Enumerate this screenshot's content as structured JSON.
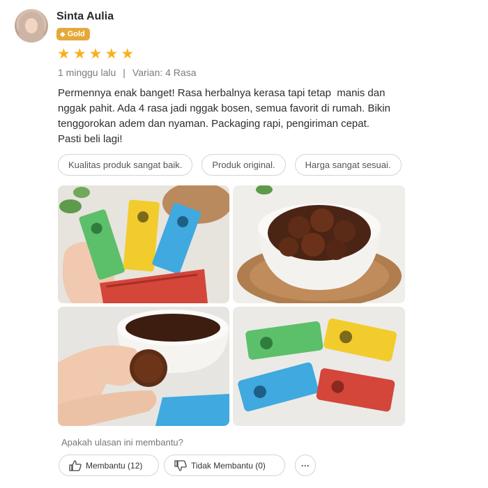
{
  "reviewer": {
    "name": "Sinta Aulia",
    "badge": "Gold",
    "badge_icon": "diamond-icon",
    "rating": 5
  },
  "meta": {
    "time": "1 minggu lalu",
    "separator": "|",
    "variant": "Varian: 4 Rasa"
  },
  "review": {
    "line1": "Permennya enak banget! Rasa herbalnya kerasa tapi tetap  manis dan",
    "line2": "nggak pahit. Ada 4 rasa jadi nggak bosen, semua favorit di rumah. Bikin",
    "line3": "tenggorokan adem dan nyaman. Packaging rapi, pengiriman cepat.",
    "line4": "Pasti beli lagi!"
  },
  "tags": [
    "Kualitas produk sangat baik.",
    "Produk original.",
    "Harga sangat sesuai."
  ],
  "helpful": {
    "question": "Apakah ulasan ini membantu?",
    "yes_label": "Membantu (12)",
    "no_label": "Tidak Membantu (0)",
    "more_label": "···"
  },
  "colors": {
    "star": "#f6b21b",
    "badge": "#e5a93a",
    "candy_green": "#5cbf6a",
    "candy_yellow": "#f2cc2c",
    "candy_blue": "#3fa9e0",
    "candy_red": "#d4453a"
  }
}
